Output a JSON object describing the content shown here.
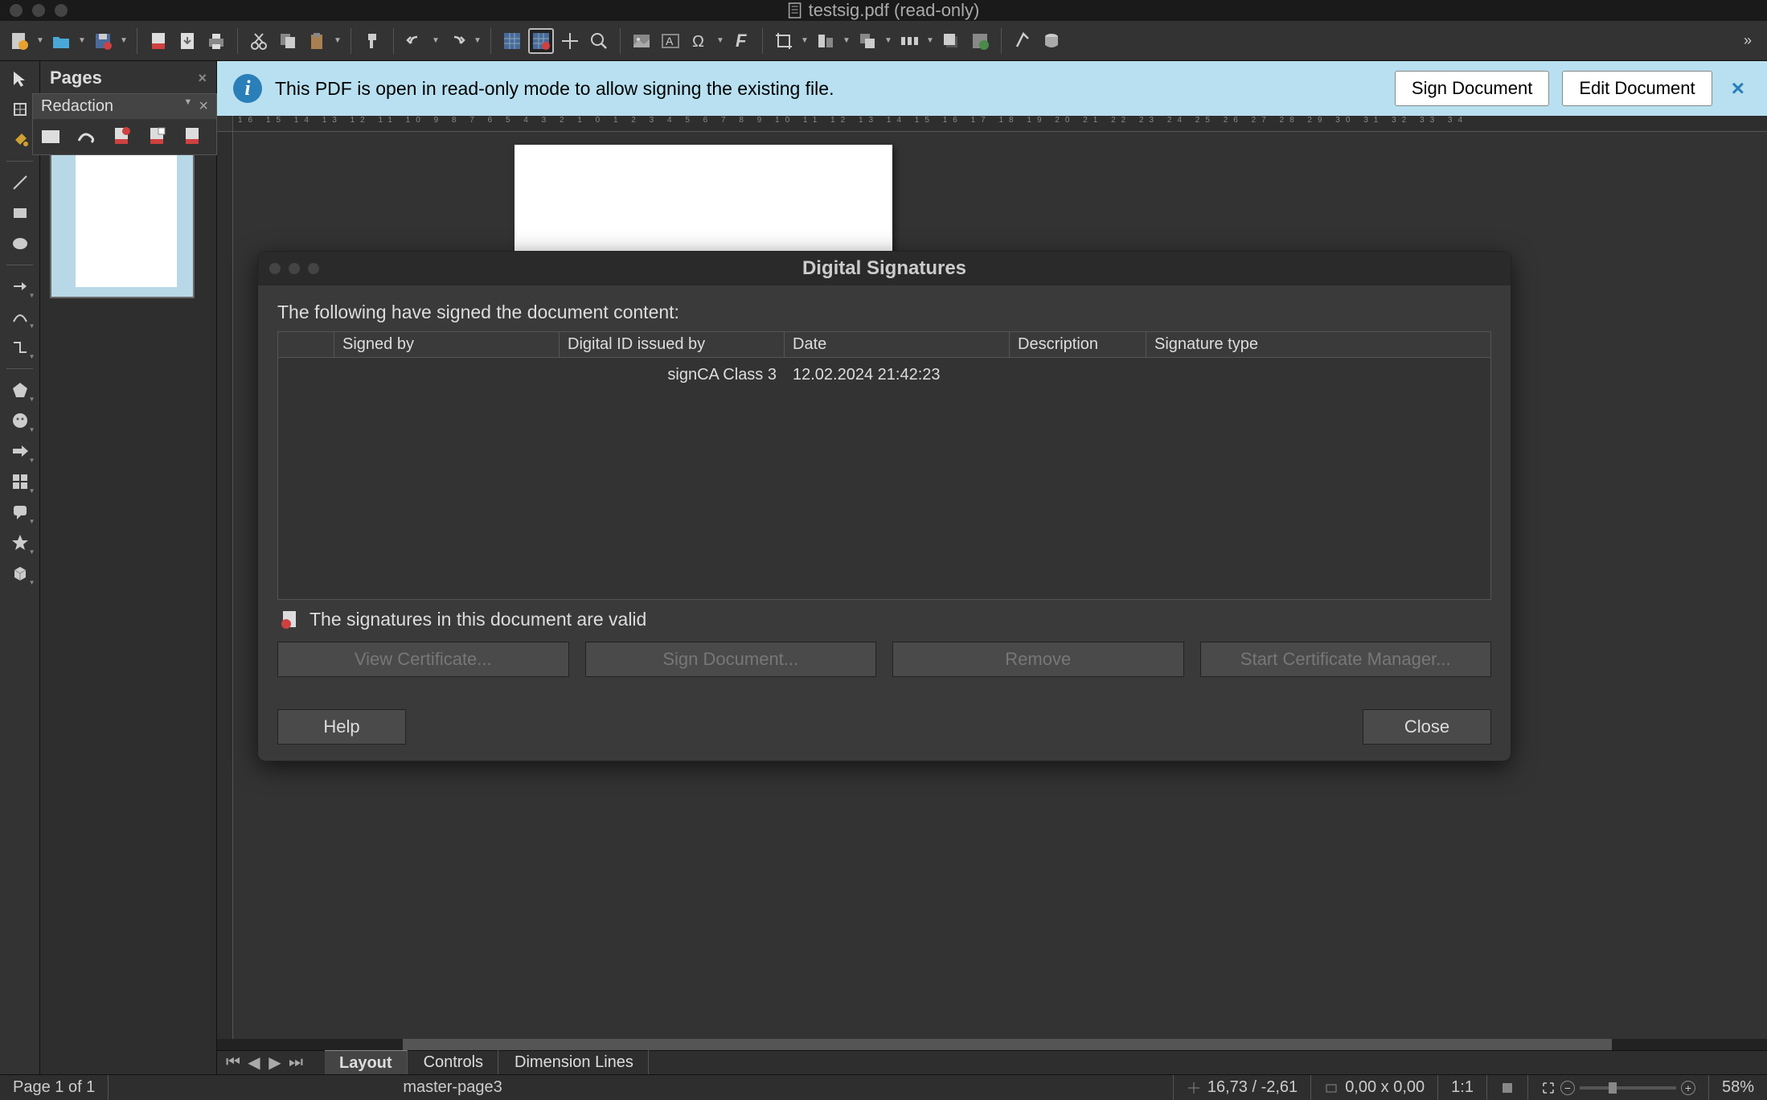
{
  "window": {
    "title": "testsig.pdf (read-only)"
  },
  "info_bar": {
    "message": "This PDF is open in read-only mode to allow signing the existing file.",
    "sign_btn": "Sign Document",
    "edit_btn": "Edit Document"
  },
  "pages_panel": {
    "title": "Pages"
  },
  "redaction": {
    "title": "Redaction"
  },
  "bottom_tabs": {
    "layout": "Layout",
    "controls": "Controls",
    "dimension": "Dimension Lines"
  },
  "status": {
    "page": "Page 1 of 1",
    "master": "master-page3",
    "coords": "16,73 / -2,61",
    "size": "0,00 x 0,00",
    "scale": "1:1",
    "zoom": "58%"
  },
  "modal": {
    "title": "Digital Signatures",
    "heading": "The following have signed the document content:",
    "columns": {
      "signed_by": "Signed by",
      "issued_by": "Digital ID issued by",
      "date": "Date",
      "description": "Description",
      "sig_type": "Signature type"
    },
    "rows": [
      {
        "signed_by": "",
        "issued_by": "signCA Class 3",
        "date": "12.02.2024 21:42:23",
        "description": "",
        "sig_type": ""
      }
    ],
    "status_text": "The signatures in this document are valid",
    "buttons": {
      "view_cert": "View Certificate...",
      "sign_doc": "Sign Document...",
      "remove": "Remove",
      "cert_mgr": "Start Certificate Manager...",
      "help": "Help",
      "close": "Close"
    }
  },
  "ruler_numbers": [
    "16",
    "15",
    "14",
    "13",
    "12",
    "11",
    "10",
    "9",
    "8",
    "7",
    "6",
    "5",
    "4",
    "3",
    "2",
    "1",
    "0",
    "1",
    "2",
    "3",
    "4",
    "5",
    "6",
    "7",
    "8",
    "9",
    "10",
    "11",
    "12",
    "13",
    "14",
    "15",
    "16",
    "17",
    "18",
    "19",
    "20",
    "21",
    "22",
    "23",
    "24",
    "25",
    "26",
    "27",
    "28",
    "29",
    "30",
    "31",
    "32",
    "33",
    "34"
  ]
}
